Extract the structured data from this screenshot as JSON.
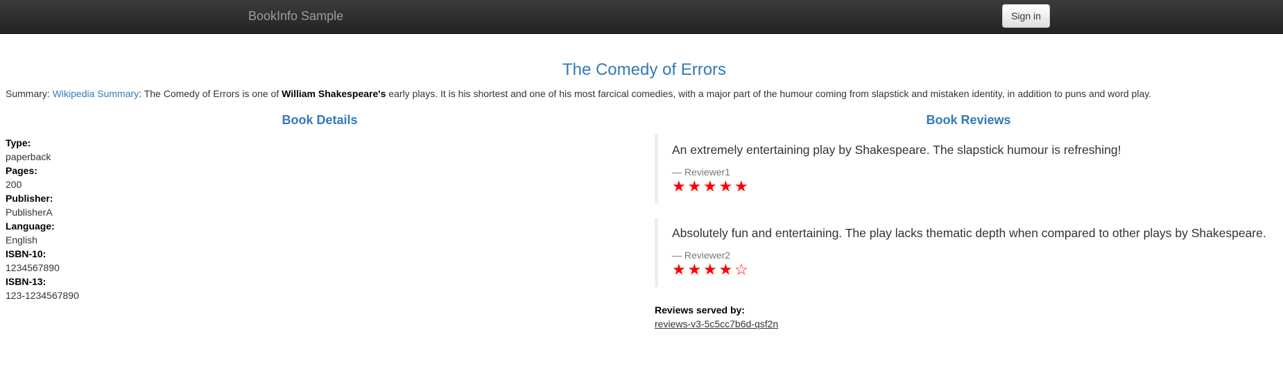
{
  "navbar": {
    "brand": "BookInfo Sample",
    "signin_label": "Sign in"
  },
  "book": {
    "title": "The Comedy of Errors",
    "summary_label": "Summary: ",
    "summary_link": "Wikipedia Summary",
    "summary_text_1": ": The Comedy of Errors is one of ",
    "summary_bold": "William Shakespeare's",
    "summary_text_2": " early plays. It is his shortest and one of his most farcical comedies, with a major part of the humour coming from slapstick and mistaken identity, in addition to puns and word play."
  },
  "details": {
    "heading": "Book Details",
    "items": [
      {
        "label": "Type:",
        "value": "paperback"
      },
      {
        "label": "Pages:",
        "value": "200"
      },
      {
        "label": "Publisher:",
        "value": "PublisherA"
      },
      {
        "label": "Language:",
        "value": "English"
      },
      {
        "label": "ISBN-10:",
        "value": "1234567890"
      },
      {
        "label": "ISBN-13:",
        "value": "123-1234567890"
      }
    ]
  },
  "reviews": {
    "heading": "Book Reviews",
    "star_color": "#ff0000",
    "items": [
      {
        "text": "An extremely entertaining play by Shakespeare. The slapstick humour is refreshing!",
        "author": "— Reviewer1",
        "rating": 5,
        "max_rating": 5
      },
      {
        "text": "Absolutely fun and entertaining. The play lacks thematic depth when compared to other plays by Shakespeare.",
        "author": "— Reviewer2",
        "rating": 4,
        "max_rating": 5
      }
    ],
    "served_by_label": "Reviews served by:",
    "served_by_value": "reviews-v3-5c5cc7b6d-qsf2n"
  },
  "colors": {
    "navbar_bg": "#222222",
    "accent": "#337ab7"
  }
}
